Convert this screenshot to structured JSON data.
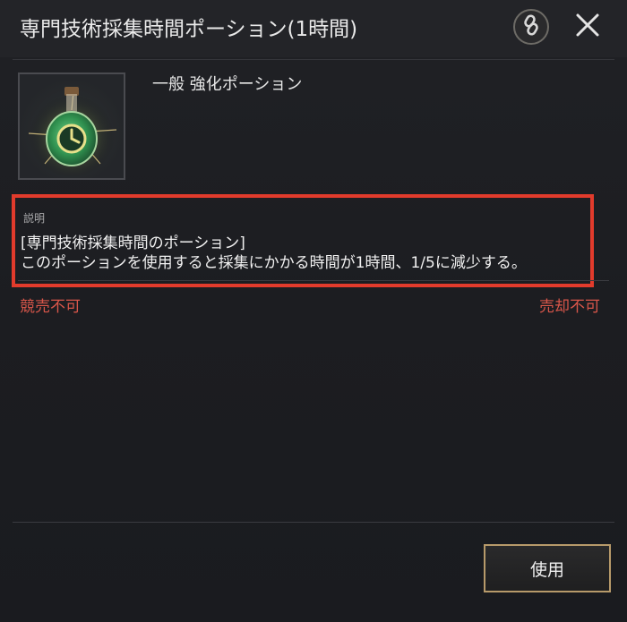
{
  "window": {
    "title": "専門技術採集時間ポーション(1時間)"
  },
  "header": {
    "link_icon": "link-chain-icon",
    "close_icon": "close-x-icon"
  },
  "item": {
    "icon": "potion-clock-icon",
    "grade_type": "一般  強化ポーション"
  },
  "description": {
    "label": "説明",
    "title": "[専門技術採集時間のポーション]",
    "body": "このポーションを使用すると採集にかかる時間が1時間、1/5に減少する。"
  },
  "restrictions": {
    "auction": "競売不可",
    "sell": "売却不可"
  },
  "actions": {
    "use_label": "使用"
  },
  "colors": {
    "highlight_border": "#e23b2c",
    "restriction_text": "#d9564a",
    "button_border": "#b79a6a"
  }
}
